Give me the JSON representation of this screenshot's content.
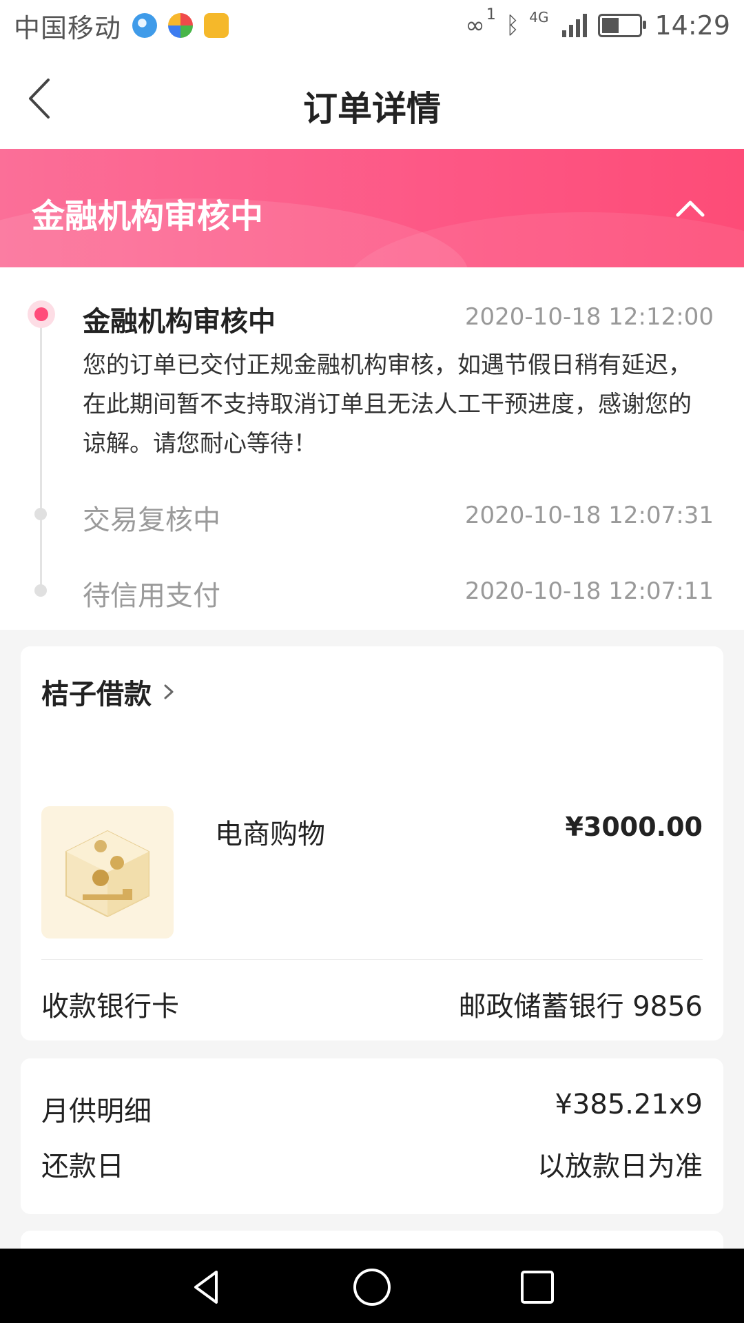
{
  "status_bar": {
    "carrier": "中国移动",
    "hd_sup": "1",
    "network": "4G",
    "time": "14:29"
  },
  "header": {
    "title": "订单详情"
  },
  "banner": {
    "title": "金融机构审核中"
  },
  "timeline": [
    {
      "title": "金融机构审核中",
      "time": "2020-10-18 12:12:00",
      "description": "您的订单已交付正规金融机构审核，如遇节假日稍有延迟，在此期间暂不支持取消订单且无法人工干预进度，感谢您的谅解。请您耐心等待！"
    },
    {
      "title": "交易复核中",
      "time": "2020-10-18 12:07:31"
    },
    {
      "title": "待信用支付",
      "time": "2020-10-18 12:07:11"
    }
  ],
  "order_card": {
    "lender": "桔子借款",
    "product_name": "电商购物",
    "price": "¥3000.00",
    "bank_label": "收款银行卡",
    "bank_value": "邮政储蓄银行 9856"
  },
  "repay_card": {
    "monthly_label": "月供明细",
    "monthly_value": "¥385.21x9",
    "due_label": "还款日",
    "due_value": "以放款日为准"
  },
  "colors": {
    "accent": "#fd5785",
    "banner_start": "#fb6f98",
    "banner_end": "#fd4c77",
    "active_dot": "#ff4c7a",
    "page_bg": "#f5f5f5"
  },
  "icons": {
    "back": "back-arrow-icon",
    "collapse": "chevron-up-icon",
    "lender_more": "chevron-right-icon",
    "product": "coin-box-icon",
    "nav_back": "triangle-back-icon",
    "nav_home": "circle-home-icon",
    "nav_recent": "square-recent-icon"
  }
}
